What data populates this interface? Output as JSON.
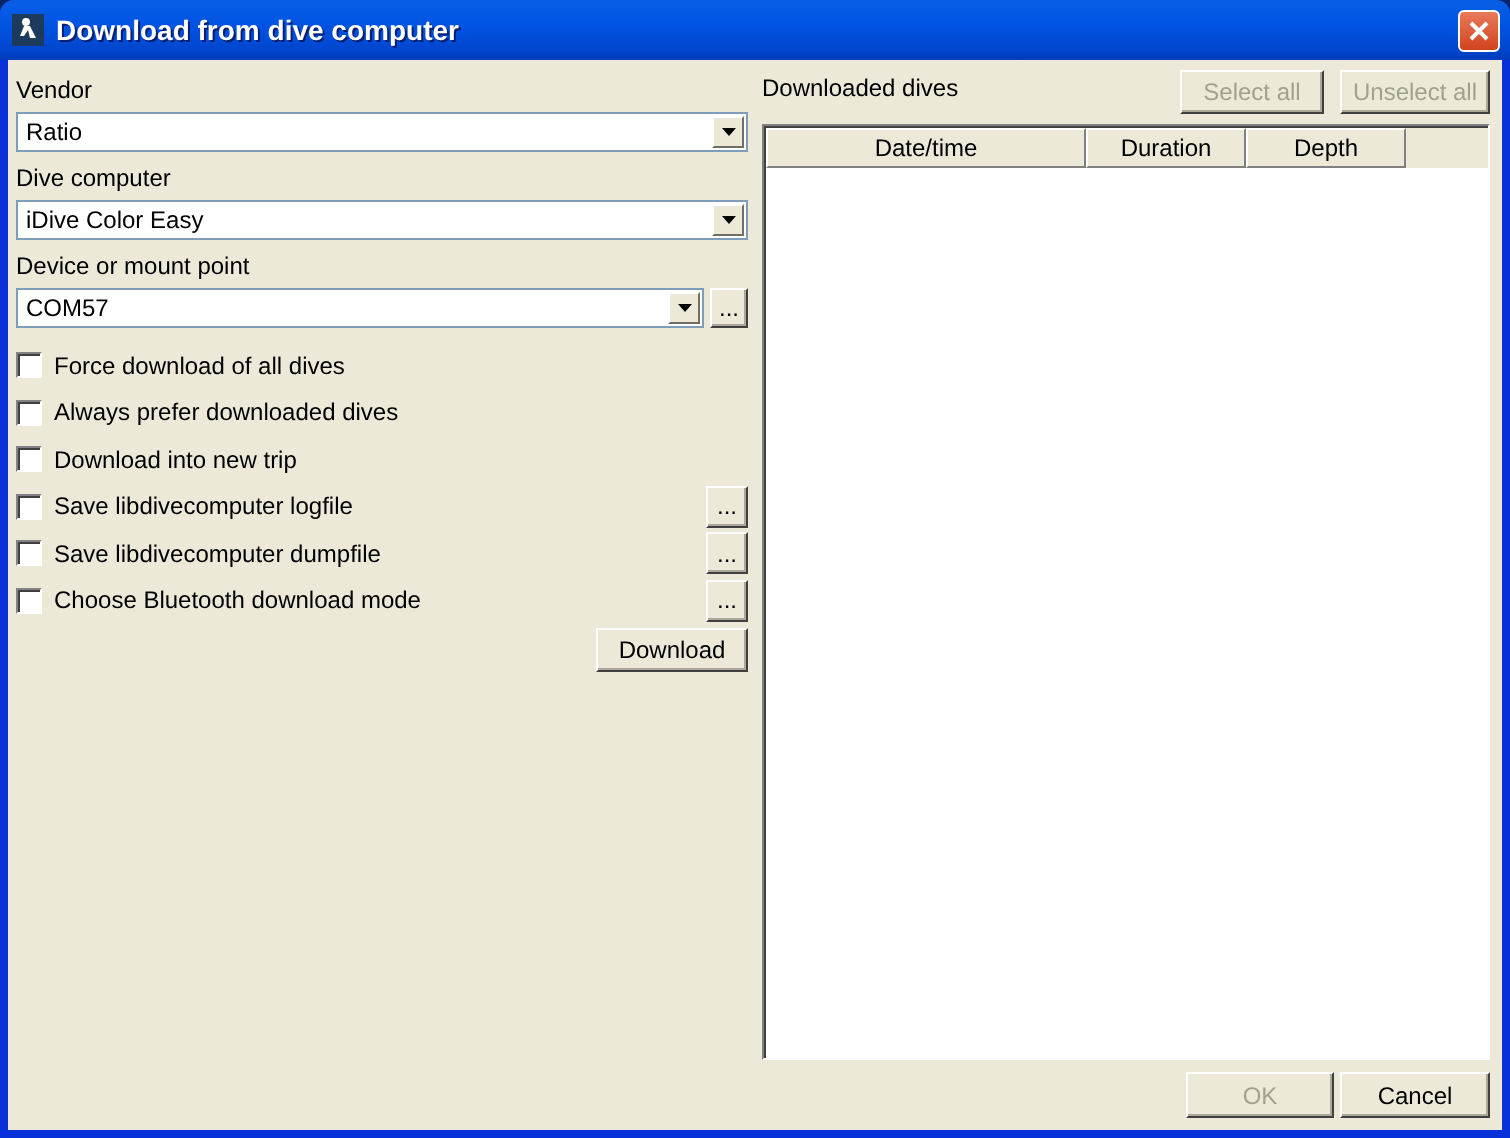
{
  "window": {
    "title": "Download from dive computer"
  },
  "fields": [
    {
      "label": "Vendor",
      "value": "Ratio"
    },
    {
      "label": "Dive computer",
      "value": "iDive Color Easy"
    },
    {
      "label": "Device or mount point",
      "value": "COM57",
      "browse": "..."
    }
  ],
  "options": [
    {
      "label": "Force download of all dives",
      "checked": false
    },
    {
      "label": "Always prefer downloaded dives",
      "checked": false
    },
    {
      "label": "Download into new trip",
      "checked": false
    },
    {
      "label": "Save libdivecomputer logfile",
      "checked": false,
      "browse": "..."
    },
    {
      "label": "Save libdivecomputer dumpfile",
      "checked": false,
      "browse": "..."
    },
    {
      "label": "Choose Bluetooth download mode",
      "checked": false,
      "browse": "..."
    }
  ],
  "download_button": {
    "label": "Download",
    "disabled": false
  },
  "dives": {
    "title": "Downloaded dives",
    "buttons": [
      {
        "label": "Select all",
        "disabled": true
      },
      {
        "label": "Unselect all",
        "disabled": true
      }
    ],
    "columns": [
      "Date/time",
      "Duration",
      "Depth"
    ]
  },
  "footer_buttons": [
    {
      "label": "OK",
      "disabled": true
    },
    {
      "label": "Cancel",
      "disabled": false
    }
  ]
}
